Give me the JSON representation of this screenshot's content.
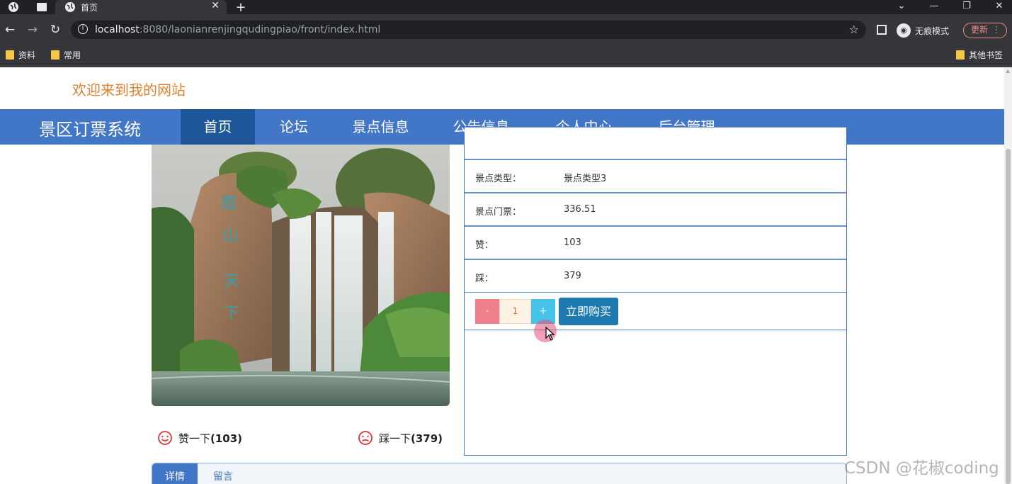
{
  "browser": {
    "tab_title": "首页",
    "url_host": "localhost",
    "url_rest": ":8080/laonianrenjingqudingpiao/front/index.html",
    "incognito_label": "无痕模式",
    "update_label": "更新",
    "bookmarks": [
      "资料",
      "常用"
    ],
    "other_bookmarks": "其他书签"
  },
  "site": {
    "welcome": "欢迎来到我的网站",
    "brand": "景区订票系统",
    "nav": [
      "首页",
      "论坛",
      "景点信息",
      "公告信息",
      "个人中心",
      "后台管理"
    ],
    "active_nav": "首页"
  },
  "attraction": {
    "fields": [
      {
        "label": "景点类型：",
        "value": "景点类型3"
      },
      {
        "label": "景点门票：",
        "value": "336.51"
      },
      {
        "label": "赞：",
        "value": "103"
      },
      {
        "label": "踩：",
        "value": "379"
      }
    ],
    "quantity": "1",
    "minus_label": "-",
    "plus_label": "+",
    "buy_label": "立即购买",
    "like_label": "赞一下",
    "like_count": "(103)",
    "dislike_label": "踩一下",
    "dislike_count": "(379)"
  },
  "detail_tabs": [
    "详情",
    "留言"
  ],
  "watermark": "CSDN @花椒coding",
  "colors": {
    "nav_bg": "#4277c8",
    "nav_active": "#1e5799",
    "welcome": "#e0812f",
    "minus": "#ee7f8a",
    "plus": "#47c3ea",
    "buy": "#1d79ae"
  }
}
